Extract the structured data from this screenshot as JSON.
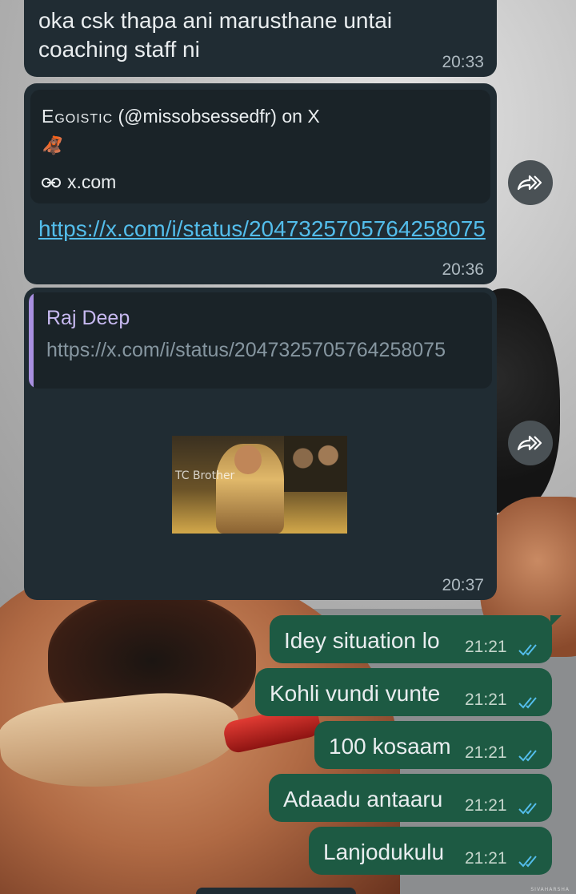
{
  "wallpaper": {
    "watermark": "SIVAHARSHA"
  },
  "messages": [
    {
      "direction": "incoming",
      "text": "oka csk thapa ani marusthane untai coaching staff ni",
      "time": "20:33"
    },
    {
      "direction": "incoming",
      "preview": {
        "title_caps": "Egoistic",
        "title_rest": " (@missobsessedfr) on X",
        "emoji": "🦧",
        "domain": "x.com"
      },
      "url": "https://x.com/i/status/2047325705764258075",
      "time": "20:36"
    },
    {
      "direction": "incoming",
      "quote": {
        "name": "Raj Deep",
        "text": "https://x.com/i/status/2047325705764258075"
      },
      "gif_watermark": "TC Brother",
      "time": "20:37"
    }
  ],
  "outgoing": [
    {
      "text": "Idey situation lo",
      "time": "21:21"
    },
    {
      "text": "Kohli vundi vunte",
      "time": "21:21"
    },
    {
      "text": "100 kosaam",
      "time": "21:21"
    },
    {
      "text": "Adaadu antaaru",
      "time": "21:21"
    },
    {
      "text": "Lanjodukulu",
      "time": "21:21"
    }
  ],
  "colors": {
    "incoming_bubble": "#202c33",
    "outgoing_bubble": "#1d5a43",
    "link": "#53bdeb",
    "read_ticks": "#53bdeb",
    "quote_accent": "#a88fe0"
  },
  "icons": {
    "forward": "forward-icon",
    "link": "link-icon",
    "read_receipt": "double-check-icon"
  }
}
